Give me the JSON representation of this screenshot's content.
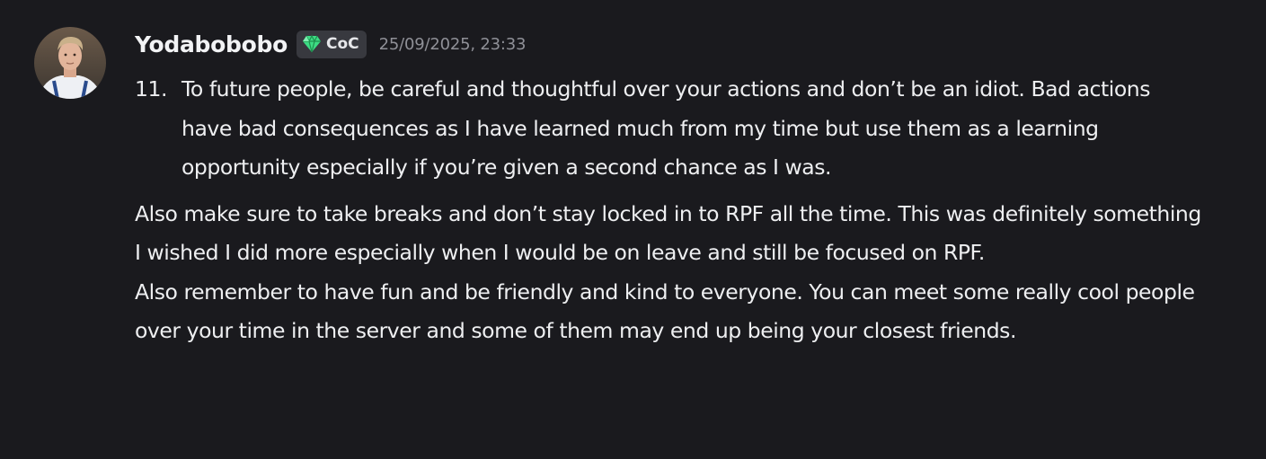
{
  "message": {
    "author": "Yodabobobo",
    "tag": {
      "icon": "gem-icon",
      "text": "CoC",
      "gem_color": "#3ddc84"
    },
    "timestamp": "25/09/2025, 23:33",
    "list_item": {
      "number": "11.",
      "text": "To future people, be careful and thoughtful over your actions and don’t be an idiot. Bad actions have bad consequences as I have learned much from my time but use them as a learning opportunity especially if you’re given a second chance as I was."
    },
    "paragraph_1": "Also make sure to take breaks and don’t stay locked in to RPF all the time. This was definitely something I wished I did more especially when I would be on leave and still be focused on RPF.",
    "paragraph_2": "Also remember to have fun and be friendly and kind to everyone. You can meet some really cool people over your time in the server and some of them may end up being your closest friends."
  },
  "colors": {
    "background": "#1a1a1e",
    "text": "#eeeff1",
    "username": "#f2f3f5",
    "timestamp": "#8f9097",
    "tag_background": "#38393f"
  }
}
